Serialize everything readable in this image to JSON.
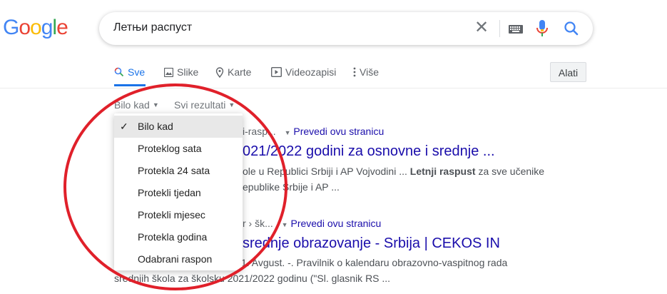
{
  "logo": {
    "letters": [
      "G",
      "o",
      "o",
      "g",
      "l",
      "e"
    ],
    "colors": [
      "#4285f4",
      "#ea4335",
      "#fbbc05",
      "#4285f4",
      "#34a853",
      "#ea4335"
    ]
  },
  "search": {
    "query": "Летњи распуст",
    "clear_glyph": "✕"
  },
  "tabs": [
    {
      "label": "Sve",
      "icon": "search-icon"
    },
    {
      "label": "Slike",
      "icon": "image-icon"
    },
    {
      "label": "Karte",
      "icon": "map-pin-icon"
    },
    {
      "label": "Videozapisi",
      "icon": "video-icon"
    },
    {
      "label": "Više",
      "icon": "more-vert-icon"
    }
  ],
  "tools": {
    "label": "Alati"
  },
  "filters": {
    "time": "Bilo kad",
    "results": "Svi rezultati"
  },
  "dropdown": {
    "check": "✓",
    "items": [
      "Bilo kad",
      "Proteklog sata",
      "Protekla 24 sata",
      "Protekli tjedan",
      "Protekli mjesec",
      "Protekla godina",
      "Odabrani raspon"
    ]
  },
  "results": [
    {
      "url": "i-rasp...",
      "translate": "Prevedi ovu stranicu",
      "title": "021/2022 godini za osnovne i srednje ...",
      "snippet1_pre": "ole u Republici Srbiji i AP Vojvodini ... ",
      "snippet1_bold": "Letnji raspust",
      "snippet1_post": " za sve učenike",
      "snippet2": "epublike Srbije i AP ..."
    },
    {
      "url": "r › šk...",
      "translate": "Prevedi ovu stranicu",
      "title": "srednje obrazovanje - Srbija | CEKOS IN",
      "snippet1": "1. Avgust. -. Pravilnik o kalendaru obrazovno-vaspitnog rada",
      "snippet2": "srednjih škola za školsku 2021/2022 godinu (\"Sl. glasnik RS ..."
    }
  ],
  "colors": {
    "accent": "#1a73e8",
    "link": "#1a0dab",
    "annotation": "#e0202a"
  }
}
